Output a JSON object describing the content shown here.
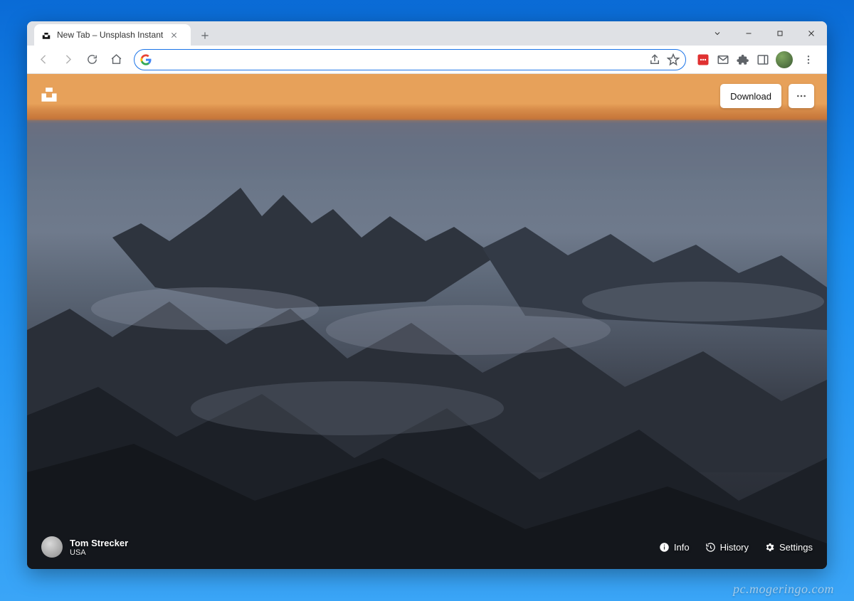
{
  "tab": {
    "title": "New Tab – Unsplash Instant"
  },
  "omnibox": {
    "value": "",
    "placeholder": ""
  },
  "ext_icons": {
    "pocket": "pocket-icon",
    "gmail": "gmail-icon",
    "extensions": "extensions-icon",
    "sidepanel": "sidepanel-icon"
  },
  "page": {
    "download_label": "Download",
    "author": {
      "name": "Tom Strecker",
      "location": "USA"
    },
    "actions": {
      "info": "Info",
      "history": "History",
      "settings": "Settings"
    }
  },
  "watermark": "pc.mogeringo.com"
}
